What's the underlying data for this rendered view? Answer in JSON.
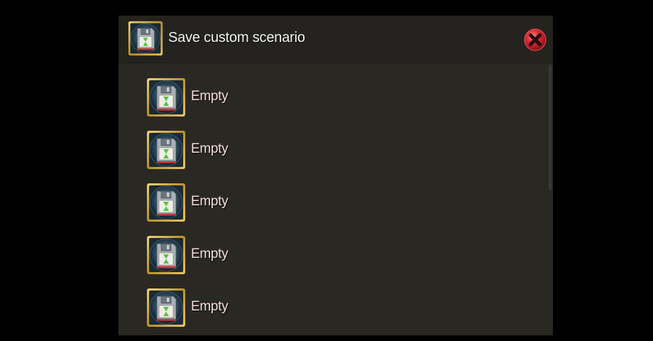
{
  "dialog": {
    "title": "Save custom scenario",
    "close_icon": "close-icon",
    "title_icon": "floppy-disk-icon"
  },
  "slots": [
    {
      "label": "Empty",
      "icon": "floppy-disk-icon"
    },
    {
      "label": "Empty",
      "icon": "floppy-disk-icon"
    },
    {
      "label": "Empty",
      "icon": "floppy-disk-icon"
    },
    {
      "label": "Empty",
      "icon": "floppy-disk-icon"
    },
    {
      "label": "Empty",
      "icon": "floppy-disk-icon"
    }
  ],
  "colors": {
    "background": "#000000",
    "dialog_body": "#2a2822",
    "title_bar": "#24231f",
    "slot_text": "#f4dede",
    "icon_gold_frame": "#c8a43a",
    "close_red": "#d42a35"
  }
}
